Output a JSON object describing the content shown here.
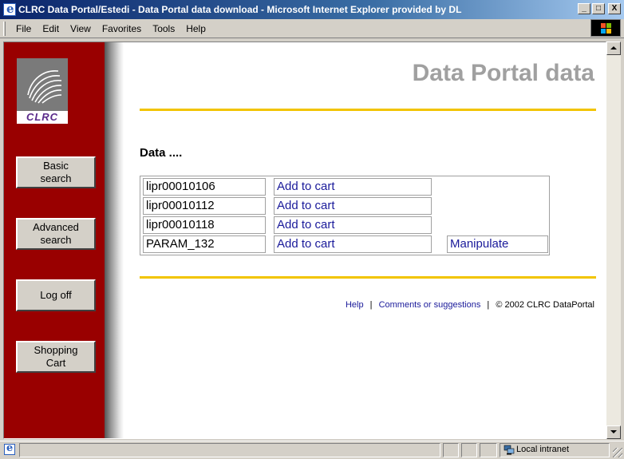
{
  "window": {
    "title": "CLRC Data Portal/Estedi - Data Portal data download - Microsoft Internet Explorer provided by DL",
    "controls": [
      "_",
      "□",
      "X"
    ]
  },
  "menubar": {
    "items": [
      "File",
      "Edit",
      "View",
      "Favorites",
      "Tools",
      "Help"
    ]
  },
  "sidebar": {
    "logo_text": "CLRC",
    "nav": [
      {
        "label": "Basic\nsearch"
      },
      {
        "label": "Advanced\nsearch"
      },
      {
        "label": "Log off"
      },
      {
        "label": "Shopping\nCart"
      }
    ]
  },
  "main": {
    "page_title": "Data Portal data",
    "section_label": "Data ....",
    "rows": [
      {
        "name": "lipr00010106",
        "action": "Add to cart",
        "extra": ""
      },
      {
        "name": "lipr00010112",
        "action": "Add to cart",
        "extra": ""
      },
      {
        "name": "lipr00010118",
        "action": "Add to cart",
        "extra": ""
      },
      {
        "name": "PARAM_132",
        "action": "Add to cart",
        "extra": "Manipulate"
      }
    ]
  },
  "footer": {
    "help": "Help",
    "separator": "|",
    "comments": "Comments or suggestions",
    "copyright": "© 2002 CLRC DataPortal"
  },
  "statusbar": {
    "zone": "Local intranet"
  },
  "colors": {
    "sidebar": "#990000",
    "rule": "#f2c400",
    "title_gray": "#a0a0a0",
    "link": "#1a1a9a"
  }
}
